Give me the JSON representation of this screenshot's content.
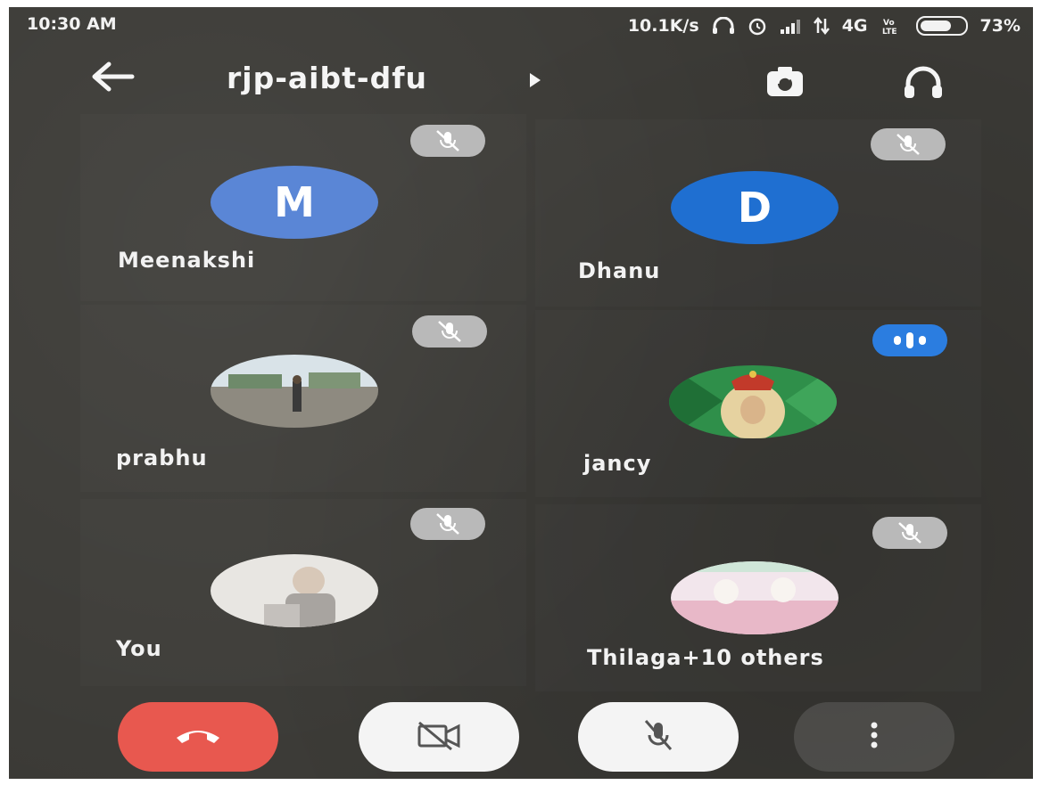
{
  "status_bar": {
    "time": "10:30 AM",
    "network_speed": "10.1K/s",
    "network_type": "4G",
    "volte": "Vo LTE",
    "battery_percent": "73%",
    "battery_level": 0.73
  },
  "toolbar": {
    "meeting_code": "rjp-aibt-dfu",
    "back_icon": "arrow-left-icon",
    "switch_camera_icon": "camera-switch-icon",
    "audio_output_icon": "headphones-icon"
  },
  "participants": [
    {
      "name": "Meenakshi",
      "initial": "M",
      "avatar_color": "#5a86d6",
      "mic": "muted"
    },
    {
      "name": "Dhanu",
      "initial": "D",
      "avatar_color": "#1f6fd1",
      "mic": "muted"
    },
    {
      "name": "prabhu",
      "initial": "",
      "avatar_type": "photo-outdoor",
      "mic": "muted"
    },
    {
      "name": "jancy",
      "initial": "",
      "avatar_type": "photo-religious",
      "mic": "speaking"
    },
    {
      "name": "You",
      "initial": "",
      "avatar_type": "photo-child",
      "mic": "muted"
    },
    {
      "name": "Thilaga+10 others",
      "initial": "",
      "avatar_type": "photo-pastel",
      "mic": "muted"
    }
  ],
  "controls": {
    "end_call_icon": "phone-hangup-icon",
    "end_call_color": "#e8584f",
    "camera_icon": "video-off-icon",
    "mic_icon": "mic-off-icon",
    "more_icon": "more-vertical-icon"
  }
}
